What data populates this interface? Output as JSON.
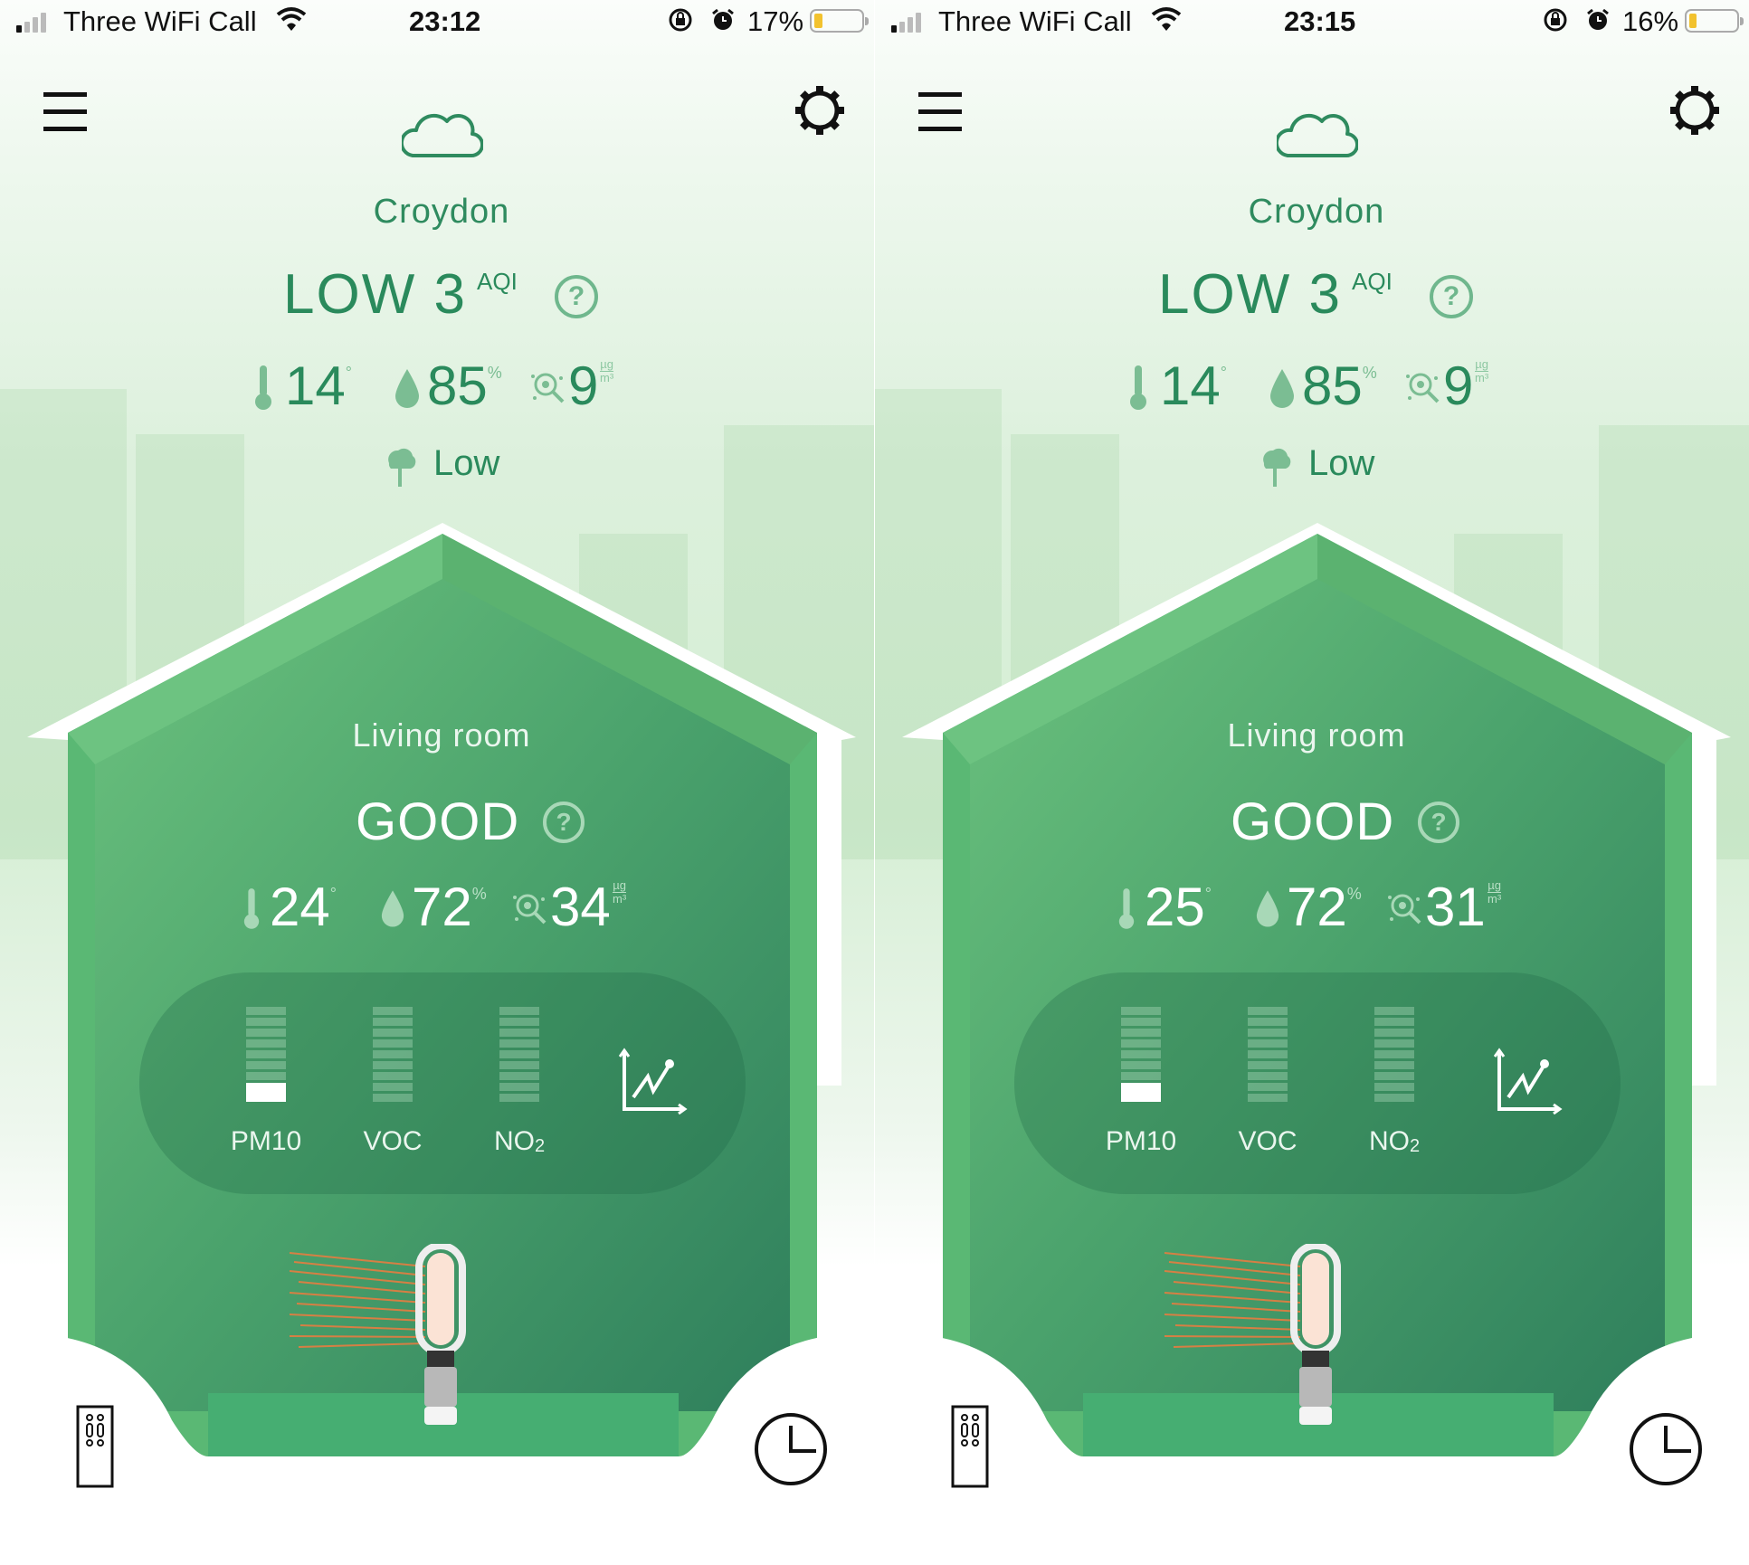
{
  "screens": [
    {
      "status_bar": {
        "carrier": "Three WiFi Call",
        "time": "23:12",
        "battery_percent": "17%",
        "battery_level": 0.17,
        "signal_bars_active": 1,
        "signal_bars_total": 4
      },
      "outdoor": {
        "weather_icon": "cloud-icon",
        "location": "Croydon",
        "aqi_level": "LOW 3",
        "aqi_label": "AQI",
        "temperature": "14",
        "temperature_unit": "°",
        "humidity": "85",
        "humidity_unit": "%",
        "particulates": "9",
        "particulates_unit_top": "µg",
        "particulates_unit_bottom": "m³",
        "pollen_level": "Low"
      },
      "indoor": {
        "room_name": "Living room",
        "quality": "GOOD",
        "temperature": "24",
        "temperature_unit": "°",
        "humidity": "72",
        "humidity_unit": "%",
        "particulates": "34",
        "particulates_unit_top": "µg",
        "particulates_unit_bottom": "m³",
        "pollutants": [
          {
            "name": "PM10",
            "level": 1,
            "max": 10
          },
          {
            "name": "VOC",
            "level": 0,
            "max": 10
          },
          {
            "name": "NO",
            "sub": "2",
            "level": 0,
            "max": 10
          }
        ]
      }
    },
    {
      "status_bar": {
        "carrier": "Three WiFi Call",
        "time": "23:15",
        "battery_percent": "16%",
        "battery_level": 0.16,
        "signal_bars_active": 1,
        "signal_bars_total": 4
      },
      "outdoor": {
        "weather_icon": "cloud-icon",
        "location": "Croydon",
        "aqi_level": "LOW 3",
        "aqi_label": "AQI",
        "temperature": "14",
        "temperature_unit": "°",
        "humidity": "85",
        "humidity_unit": "%",
        "particulates": "9",
        "particulates_unit_top": "µg",
        "particulates_unit_bottom": "m³",
        "pollen_level": "Low"
      },
      "indoor": {
        "room_name": "Living room",
        "quality": "GOOD",
        "temperature": "25",
        "temperature_unit": "°",
        "humidity": "72",
        "humidity_unit": "%",
        "particulates": "31",
        "particulates_unit_top": "µg",
        "particulates_unit_bottom": "m³",
        "pollutants": [
          {
            "name": "PM10",
            "level": 1,
            "max": 10
          },
          {
            "name": "VOC",
            "level": 0,
            "max": 10
          },
          {
            "name": "NO",
            "sub": "2",
            "level": 0,
            "max": 10
          }
        ]
      }
    }
  ],
  "colors": {
    "brand_green": "#2a8a5c",
    "house_green": "#4caf6e",
    "battery_low": "#f2c22e"
  }
}
